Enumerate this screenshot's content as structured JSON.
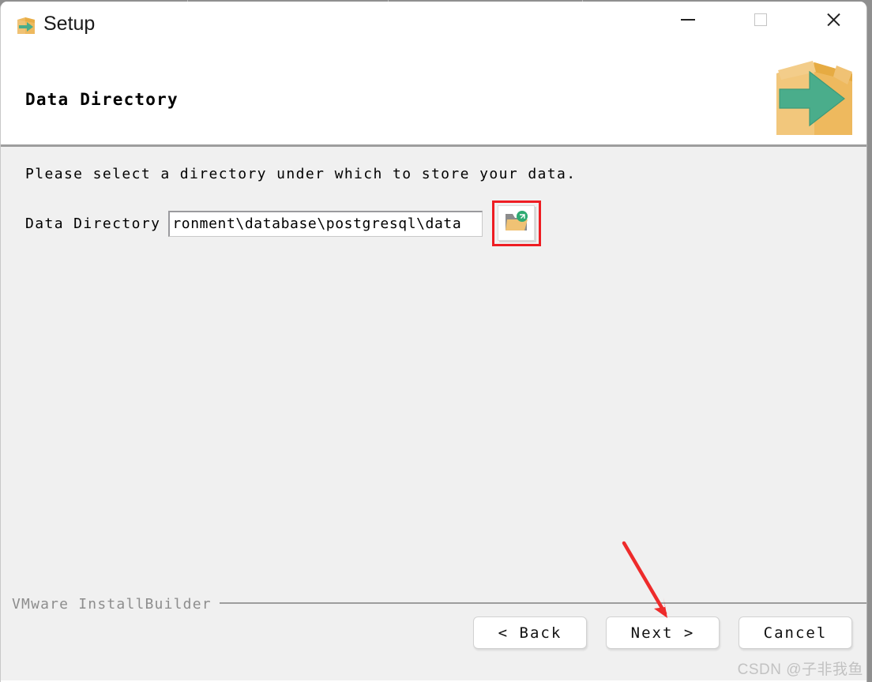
{
  "window": {
    "title": "Setup",
    "title_icon": "setup-box-arrow-icon",
    "controls": {
      "minimize": "minimize-icon",
      "maximize": "maximize-icon",
      "close": "close-icon"
    }
  },
  "header": {
    "heading": "Data Directory",
    "art_icon": "installer-box-arrow-graphic"
  },
  "body": {
    "intro": "Please select a directory under which to store your data.",
    "field": {
      "label": "Data Directory",
      "value": "ronment\\database\\postgresql\\data",
      "placeholder": "",
      "browse_icon": "folder-browse-icon"
    }
  },
  "footer": {
    "brand": "VMware InstallBuilder",
    "buttons": [
      {
        "name": "back-button",
        "label": "< Back"
      },
      {
        "name": "next-button",
        "label": "Next >"
      },
      {
        "name": "cancel-button",
        "label": "Cancel"
      }
    ]
  },
  "annotations": {
    "arrow_color": "#ee2b2b",
    "highlight_color": "#ee1d23",
    "watermark": "CSDN @子非我鱼"
  },
  "colors": {
    "window_bg": "#ffffff",
    "body_bg": "#f0f0f0",
    "rule": "#9d9d9d",
    "box_orange": "#eeb95e",
    "arrow_green": "#4aad8b"
  }
}
